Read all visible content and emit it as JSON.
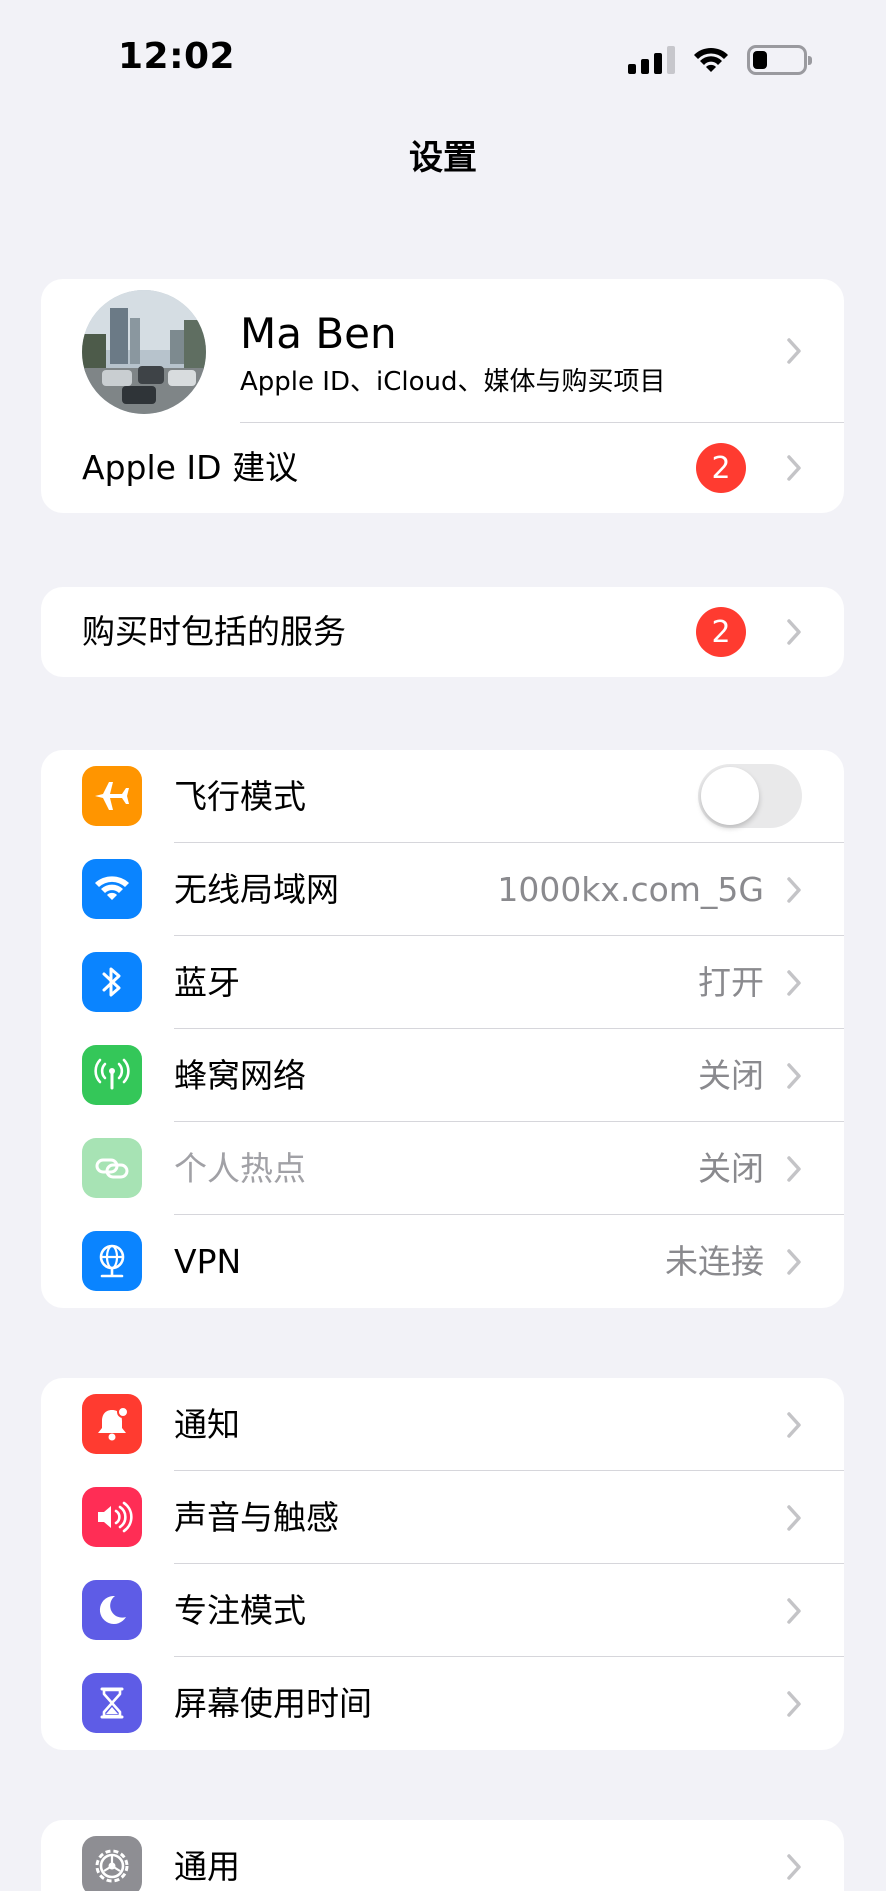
{
  "status_bar": {
    "time": "12:02",
    "battery_level_percent": 20
  },
  "nav": {
    "title": "设置"
  },
  "profile": {
    "name": "Ma Ben",
    "subtitle": "Apple ID、iCloud、媒体与购买项目",
    "suggestions_label": "Apple ID 建议",
    "suggestions_badge": "2"
  },
  "services": {
    "label": "购买时包括的服务",
    "badge": "2"
  },
  "connectivity": {
    "airplane": {
      "label": "飞行模式",
      "on": false,
      "icon": "airplane-icon",
      "color": "#ff9500"
    },
    "wifi": {
      "label": "无线局域网",
      "value": "1000kx.com_5G",
      "icon": "wifi-icon",
      "color": "#0a84ff"
    },
    "bluetooth": {
      "label": "蓝牙",
      "value": "打开",
      "icon": "bluetooth-icon",
      "color": "#0a84ff"
    },
    "cellular": {
      "label": "蜂窝网络",
      "value": "关闭",
      "icon": "cellular-antenna-icon",
      "color": "#34c759"
    },
    "hotspot": {
      "label": "个人热点",
      "value": "关闭",
      "icon": "hotspot-link-icon",
      "color": "#a7e3b4"
    },
    "vpn": {
      "label": "VPN",
      "value": "未连接",
      "icon": "vpn-globe-icon",
      "color": "#0a84ff"
    }
  },
  "attention": {
    "notifications": {
      "label": "通知",
      "icon": "bell-icon",
      "color": "#ff3b30"
    },
    "sounds": {
      "label": "声音与触感",
      "icon": "speaker-icon",
      "color": "#ff2d55"
    },
    "focus": {
      "label": "专注模式",
      "icon": "moon-icon",
      "color": "#5e5ce6"
    },
    "screen_time": {
      "label": "屏幕使用时间",
      "icon": "hourglass-icon",
      "color": "#5e5ce6"
    }
  },
  "system": {
    "general": {
      "label": "通用",
      "icon": "gear-icon",
      "color": "#8e8e93"
    }
  }
}
